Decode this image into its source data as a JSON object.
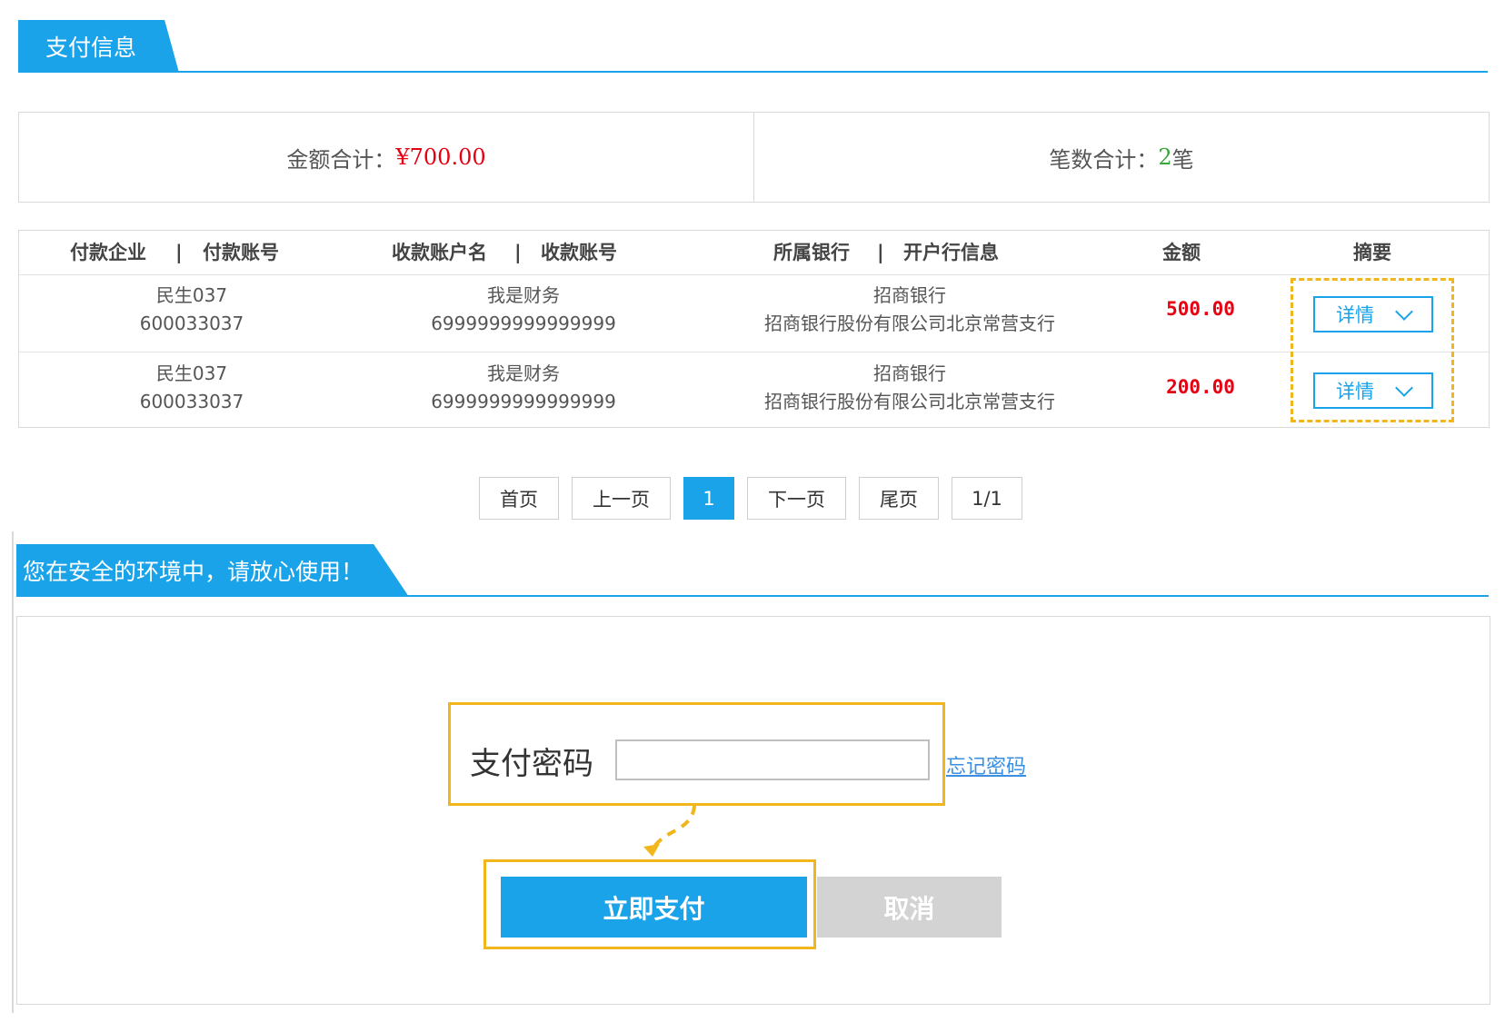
{
  "payment_section": {
    "title": "支付信息"
  },
  "summary": {
    "amount_label": "金额合计：",
    "amount_value": "¥700.00",
    "count_label": "笔数合计：",
    "count_value": "2",
    "count_unit": "笔"
  },
  "table": {
    "headers": {
      "payer": "付款企业",
      "payer_account": "付款账号",
      "payee_name": "收款账户名",
      "payee_account": "收款账号",
      "bank": "所属银行",
      "branch": "开户行信息",
      "amount": "金额",
      "summary": "摘要",
      "separator": "|"
    },
    "rows": [
      {
        "payer": "民生037",
        "payer_account": "600033037",
        "payee_name": "我是财务",
        "payee_account": "6999999999999999",
        "bank": "招商银行",
        "branch": "招商银行股份有限公司北京常营支行",
        "amount": "500.00",
        "detail_label": "详情"
      },
      {
        "payer": "民生037",
        "payer_account": "600033037",
        "payee_name": "我是财务",
        "payee_account": "6999999999999999",
        "bank": "招商银行",
        "branch": "招商银行股份有限公司北京常营支行",
        "amount": "200.00",
        "detail_label": "详情"
      }
    ]
  },
  "pagination": {
    "first": "首页",
    "prev": "上一页",
    "current": "1",
    "next": "下一页",
    "last": "尾页",
    "info": "1/1"
  },
  "security_section": {
    "title": "您在安全的环境中，请放心使用！"
  },
  "pay_form": {
    "password_label": "支付密码",
    "password_value": "",
    "forgot_link": "忘记密码",
    "pay_button": "立即支付",
    "cancel_button": "取消"
  },
  "colors": {
    "accent": "#1aa3e8",
    "amount_red": "#e60012",
    "count_green": "#39a53a",
    "highlight_yellow": "#f2b61d",
    "cancel_gray": "#d3d3d3"
  },
  "icons": {
    "detail_dropdown": "chevron-down-icon"
  }
}
